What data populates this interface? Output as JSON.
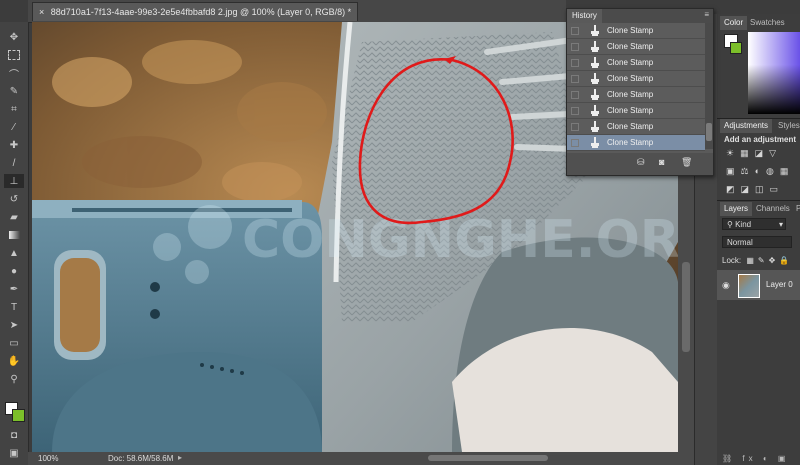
{
  "document_tab": {
    "title": "88d710a1-7f13-4aae-99e3-2e5e4fbbafd8 2.jpg @ 100% (Layer 0, RGB/8) *"
  },
  "history_panel": {
    "title": "History",
    "items": [
      "Clone Stamp",
      "Clone Stamp",
      "Clone Stamp",
      "Clone Stamp",
      "Clone Stamp",
      "Clone Stamp",
      "Clone Stamp",
      "Clone Stamp"
    ],
    "selected_index": 7
  },
  "color_panel": {
    "tabs": [
      "Color",
      "Swatches"
    ]
  },
  "adjustments_panel": {
    "tabs": [
      "Adjustments",
      "Styles"
    ],
    "subtitle": "Add an adjustment"
  },
  "layers_panel": {
    "tabs": [
      "Layers",
      "Channels",
      "Paths"
    ],
    "kind_filter": "Kind",
    "blend_mode": "Normal",
    "lock_label": "Lock:",
    "layer_name": "Layer 0"
  },
  "status": {
    "zoom": "100%",
    "doc_size": "Doc: 58.6M/58.6M"
  },
  "watermark": "CONGNGHE.ORG",
  "colors": {
    "annotation": "#e01a1a",
    "selected_row": "#7b8ea6",
    "foreground": "#ffffff",
    "background": "#7cbf2a"
  }
}
